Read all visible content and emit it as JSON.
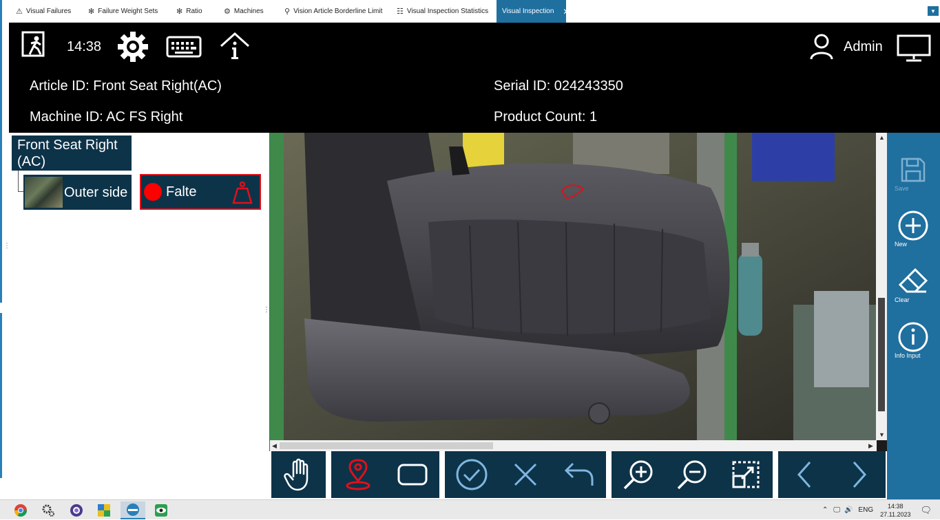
{
  "tabs": [
    {
      "label": "Visual Failures",
      "icon": "warning-icon",
      "glyph": "⚠"
    },
    {
      "label": "Failure Weight Sets",
      "icon": "fan-icon",
      "glyph": "✻"
    },
    {
      "label": "Ratio",
      "icon": "fan-icon",
      "glyph": "✻"
    },
    {
      "label": "Machines",
      "icon": "machine-icon",
      "glyph": "⚙"
    },
    {
      "label": "Vision Article Borderline Limit",
      "icon": "location-icon",
      "glyph": "⚲"
    },
    {
      "label": "Visual Inspection Statistics",
      "icon": "list-icon",
      "glyph": "☷"
    },
    {
      "label": "Visual Inspection",
      "icon": "none",
      "glyph": "",
      "active": true,
      "close": "✕"
    }
  ],
  "header": {
    "time": "14:38",
    "user": "Admin",
    "article": "Article ID: Front Seat Right(AC)",
    "serial": "Serial ID: 024243350",
    "machine": "Machine ID: AC FS Right",
    "count": "Product Count: 1"
  },
  "tree": {
    "root": "Front Seat Right (AC)",
    "child": "Outer side",
    "failure": "Falte"
  },
  "actions": {
    "save": "Save",
    "new": "New",
    "clear": "Clear",
    "info": "Info Input"
  },
  "taskbar": {
    "lang": "ENG",
    "time": "14:38",
    "date": "27.11.2023"
  },
  "colors": {
    "accent": "#1f6f9f",
    "dark_panel": "#0d3349",
    "failure_red": "#e0101a"
  }
}
